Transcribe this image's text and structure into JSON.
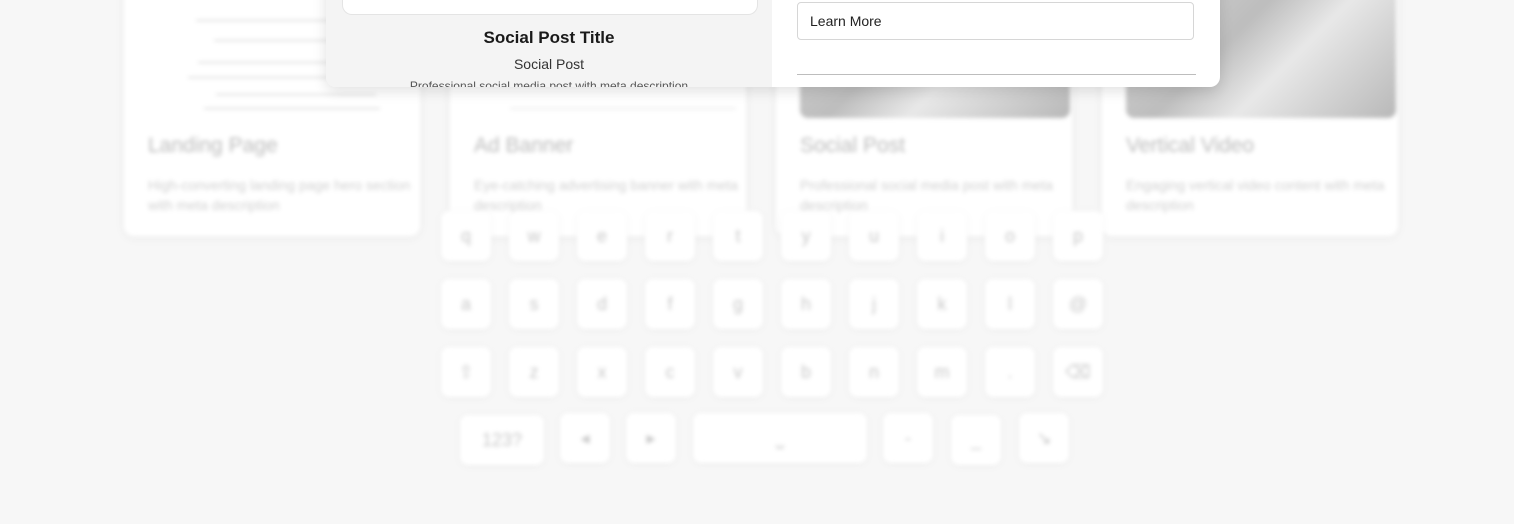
{
  "modal": {
    "preview": {
      "title": "Social Post Title",
      "subtitle": "Social Post",
      "description": "Professional social media post with meta description"
    },
    "cta_field": {
      "value": "Learn More"
    }
  },
  "background": {
    "cards": [
      {
        "title": "Landing Page",
        "description": "High-converting landing page hero section with meta description"
      },
      {
        "title": "Ad Banner",
        "description": "Eye-catching advertising banner with meta description"
      },
      {
        "title": "Social Post",
        "description": "Professional social media post with meta description"
      },
      {
        "title": "Vertical Video",
        "description": "Engaging vertical video content with meta description"
      }
    ],
    "keyboard": {
      "row1": [
        "q",
        "w",
        "e",
        "r",
        "t",
        "y",
        "u",
        "i",
        "o",
        "p"
      ],
      "row2": [
        "a",
        "s",
        "d",
        "f",
        "g",
        "h",
        "j",
        "k",
        "l",
        "@"
      ],
      "row3": [
        "⇧",
        "z",
        "x",
        "c",
        "v",
        "b",
        "n",
        "m",
        ".",
        "⌫"
      ],
      "row4": [
        "123?",
        "◂",
        "▸",
        "⎵",
        "-",
        "_",
        "↘"
      ]
    }
  }
}
